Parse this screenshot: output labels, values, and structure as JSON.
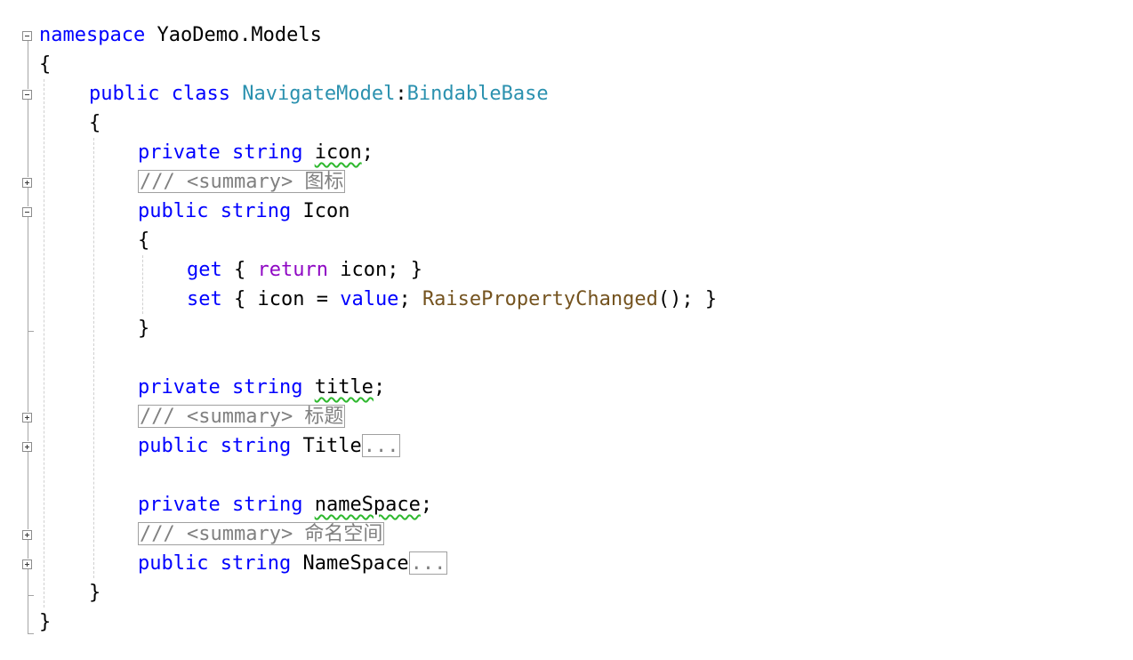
{
  "editor": {
    "lines": [
      {
        "tokens": [
          {
            "k": "kw",
            "t": "namespace"
          },
          {
            "k": "plain",
            "t": " YaoDemo.Models"
          }
        ]
      },
      {
        "tokens": [
          {
            "k": "plain",
            "t": "{"
          }
        ]
      },
      {
        "tokens": [
          {
            "k": "kw",
            "t": "public"
          },
          {
            "k": "plain",
            "t": " "
          },
          {
            "k": "kw",
            "t": "class"
          },
          {
            "k": "plain",
            "t": " "
          },
          {
            "k": "type",
            "t": "NavigateModel"
          },
          {
            "k": "plain",
            "t": ":"
          },
          {
            "k": "type",
            "t": "BindableBase"
          }
        ]
      },
      {
        "tokens": [
          {
            "k": "plain",
            "t": "{"
          }
        ]
      },
      {
        "tokens": [
          {
            "k": "kw",
            "t": "private"
          },
          {
            "k": "plain",
            "t": " "
          },
          {
            "k": "kw",
            "t": "string"
          },
          {
            "k": "plain",
            "t": " "
          },
          {
            "k": "squiggle",
            "t": "icon"
          },
          {
            "k": "plain",
            "t": ";"
          }
        ]
      },
      {
        "tokens": [
          {
            "k": "box",
            "t": "/// <summary> 图标"
          }
        ]
      },
      {
        "tokens": [
          {
            "k": "kw",
            "t": "public"
          },
          {
            "k": "plain",
            "t": " "
          },
          {
            "k": "kw",
            "t": "string"
          },
          {
            "k": "plain",
            "t": " Icon"
          }
        ]
      },
      {
        "tokens": [
          {
            "k": "plain",
            "t": "{"
          }
        ]
      },
      {
        "tokens": [
          {
            "k": "kw",
            "t": "get"
          },
          {
            "k": "plain",
            "t": " { "
          },
          {
            "k": "kw2",
            "t": "return"
          },
          {
            "k": "plain",
            "t": " icon; }"
          }
        ]
      },
      {
        "tokens": [
          {
            "k": "kw",
            "t": "set"
          },
          {
            "k": "plain",
            "t": " { icon = "
          },
          {
            "k": "kw",
            "t": "value"
          },
          {
            "k": "plain",
            "t": "; "
          },
          {
            "k": "method",
            "t": "RaisePropertyChanged"
          },
          {
            "k": "plain",
            "t": "(); }"
          }
        ]
      },
      {
        "tokens": [
          {
            "k": "plain",
            "t": "}"
          }
        ]
      },
      {
        "tokens": []
      },
      {
        "tokens": [
          {
            "k": "kw",
            "t": "private"
          },
          {
            "k": "plain",
            "t": " "
          },
          {
            "k": "kw",
            "t": "string"
          },
          {
            "k": "plain",
            "t": " "
          },
          {
            "k": "squiggle",
            "t": "title"
          },
          {
            "k": "plain",
            "t": ";"
          }
        ]
      },
      {
        "tokens": [
          {
            "k": "box",
            "t": "/// <summary> 标题"
          }
        ]
      },
      {
        "tokens": [
          {
            "k": "kw",
            "t": "public"
          },
          {
            "k": "plain",
            "t": " "
          },
          {
            "k": "kw",
            "t": "string"
          },
          {
            "k": "plain",
            "t": " Title"
          },
          {
            "k": "box",
            "t": "..."
          }
        ]
      },
      {
        "tokens": []
      },
      {
        "tokens": [
          {
            "k": "kw",
            "t": "private"
          },
          {
            "k": "plain",
            "t": " "
          },
          {
            "k": "kw",
            "t": "string"
          },
          {
            "k": "plain",
            "t": " "
          },
          {
            "k": "squiggle",
            "t": "nameSpace"
          },
          {
            "k": "plain",
            "t": ";"
          }
        ]
      },
      {
        "tokens": [
          {
            "k": "box",
            "t": "/// <summary> 命名空间"
          }
        ]
      },
      {
        "tokens": [
          {
            "k": "kw",
            "t": "public"
          },
          {
            "k": "plain",
            "t": " "
          },
          {
            "k": "kw",
            "t": "string"
          },
          {
            "k": "plain",
            "t": " NameSpace"
          },
          {
            "k": "box",
            "t": "..."
          }
        ]
      },
      {
        "tokens": [
          {
            "k": "plain",
            "t": "}"
          }
        ]
      },
      {
        "tokens": [
          {
            "k": "plain",
            "t": "}"
          }
        ]
      }
    ],
    "fold_markers": [
      {
        "line": 0,
        "state": "expanded"
      },
      {
        "line": 2,
        "state": "expanded"
      },
      {
        "line": 5,
        "state": "collapsed"
      },
      {
        "line": 6,
        "state": "expanded"
      },
      {
        "line": 13,
        "state": "collapsed"
      },
      {
        "line": 14,
        "state": "collapsed"
      },
      {
        "line": 17,
        "state": "collapsed"
      },
      {
        "line": 18,
        "state": "collapsed"
      }
    ],
    "colors": {
      "keyword": "#0000ff",
      "control_keyword": "#8f08c4",
      "type": "#2b91af",
      "method": "#74531f",
      "comment": "#808080",
      "squiggle": "#2eb82e"
    }
  }
}
